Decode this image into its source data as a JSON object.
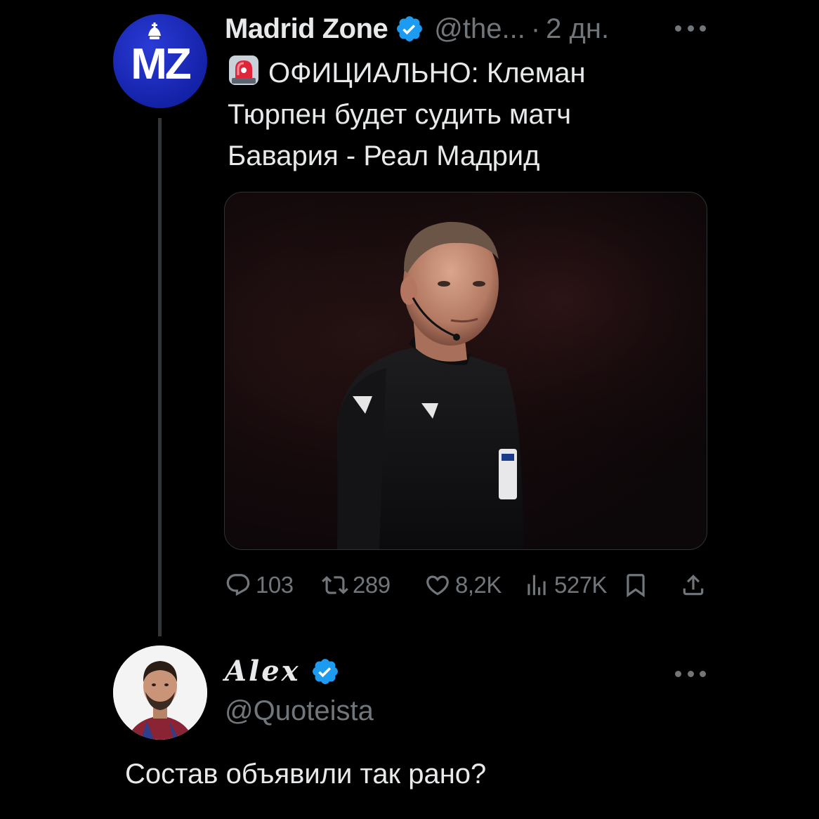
{
  "tweet": {
    "author": {
      "display_name": "Madrid Zone",
      "handle": "@the...",
      "separator": "·",
      "time": "2 дн.",
      "avatar_text": "MZ",
      "avatar_icon": "madrid-zone-logo"
    },
    "text_line1": "ОФИЦИАЛЬНО: Клеман",
    "text_line2": "Тюрпен будет судить матч",
    "text_line3": "Бавария - Реал Мадрид",
    "emoji_icon": "rotating-light-icon",
    "media": {
      "subject": "referee-photo"
    },
    "actions": {
      "replies": "103",
      "retweets": "289",
      "likes": "8,2K",
      "views": "527K"
    }
  },
  "reply": {
    "display_name": "Alex",
    "handle": "@Quoteista",
    "text": "Состав объявили так рано?"
  },
  "colors": {
    "background": "#000000",
    "text_primary": "#e7e9ea",
    "text_muted": "#71767b",
    "verified_blue": "#1d9bf0",
    "thread_line": "#333639"
  }
}
